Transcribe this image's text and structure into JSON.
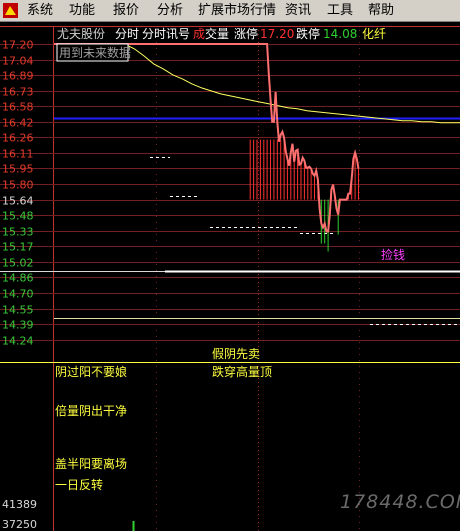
{
  "menu": [
    "系统",
    "功能",
    "报价",
    "分析",
    "扩展市场行情",
    "资讯",
    "工具",
    "帮助"
  ],
  "header": {
    "stock_name": "尤夫股份",
    "view1": "分时",
    "view2": "分时讯号",
    "vol_word1": "成",
    "vol_word2": "交量",
    "limit_up_label": "涨停",
    "limit_up_value": "17.20",
    "limit_down_label": "跌停",
    "limit_down_value": "14.08",
    "sector": "化纤"
  },
  "notice": "用到未来数据",
  "price_axis": [
    "17.20",
    "17.04",
    "16.89",
    "16.73",
    "16.58",
    "16.42",
    "16.26",
    "16.11",
    "15.95",
    "15.80",
    "15.64",
    "15.48",
    "15.33",
    "15.17",
    "15.02",
    "14.86",
    "14.70",
    "14.55",
    "14.39",
    "14.24"
  ],
  "volume_axis": [
    "41389",
    "37250"
  ],
  "annotations": {
    "a1": "假阴先卖",
    "a2": "跌穿高量顶",
    "a3": "阴过阳不要娘",
    "a4": "倍量阴出干净",
    "a5": "盖半阳要离场",
    "a6": "一日反转",
    "pickup": "捡钱"
  },
  "watermark": "178448.COM",
  "colors": {
    "up": "#ff3030",
    "down": "#30d030",
    "avg": "#ffff60",
    "blue": "#2020ff",
    "annotation": "#ffff40",
    "pickup": "#ff40ff",
    "bg": "#000000"
  },
  "chart_data": {
    "type": "line",
    "base_price": 15.64,
    "price": [
      17.2,
      17.2,
      17.2,
      17.2,
      17.2,
      17.2,
      17.2,
      17.2,
      17.2,
      17.2,
      17.2,
      17.2,
      17.2,
      17.2,
      17.2,
      17.2,
      17.2,
      17.2,
      17.2,
      17.2,
      17.2,
      17.2,
      17.2,
      17.2,
      17.2,
      17.2,
      17.2,
      17.2,
      17.2,
      17.2,
      17.2,
      17.2,
      17.2,
      17.2,
      17.2,
      17.2,
      17.2,
      17.2,
      17.2,
      17.2,
      17.2,
      17.2,
      17.2,
      17.2,
      17.2,
      17.2,
      17.2,
      17.2,
      17.2,
      17.2,
      17.2,
      17.2,
      17.2,
      17.2,
      17.2,
      17.2,
      17.2,
      17.2,
      17.2,
      17.2,
      17.2,
      17.2,
      17.2,
      17.2,
      17.2,
      17.2,
      17.2,
      17.2,
      17.2,
      17.2,
      17.2,
      17.2,
      17.2,
      17.2,
      17.2,
      17.2,
      17.2,
      17.2,
      17.2,
      17.2,
      17.2,
      17.2,
      17.2,
      17.2,
      17.2,
      17.2,
      17.2,
      17.2,
      17.2,
      17.2,
      17.2,
      17.2,
      17.2,
      17.2,
      17.2,
      17.2,
      17.2,
      17.2,
      17.2,
      17.2,
      17.2,
      17.2,
      17.2,
      17.2,
      17.2,
      17.2,
      17.2,
      17.2,
      17.2,
      17.2,
      17.2,
      17.2,
      17.2,
      17.2,
      17.2,
      17.2,
      17.2,
      17.2,
      17.2,
      17.2,
      17.2,
      17.2,
      17.2,
      17.2,
      17.2,
      17.2,
      17.2,
      16.9,
      16.65,
      16.42,
      16.42,
      16.72,
      16.42,
      16.22,
      16.29,
      16.32,
      16.26,
      16.12,
      16.05,
      15.98,
      16.11,
      16.2,
      16.02,
      16.13,
      16.14,
      15.99,
      16.0,
      16.06,
      16.03,
      15.96,
      15.96,
      15.97,
      15.95,
      15.9,
      15.88,
      15.93,
      15.84,
      15.55,
      15.4,
      15.36,
      15.4,
      15.32,
      15.32,
      15.48,
      15.74,
      15.79,
      15.68,
      15.55,
      15.49,
      15.64,
      15.64,
      15.64,
      15.64,
      15.64,
      15.7,
      15.7,
      15.85,
      16.05,
      16.11,
      16.05,
      15.95
    ],
    "avg_price": [
      17.2,
      17.15,
      17.08,
      17.0,
      16.95,
      16.89,
      16.85,
      16.8,
      16.76,
      16.73,
      16.7,
      16.68,
      16.66,
      16.64,
      16.62,
      16.6,
      16.58,
      16.56,
      16.55,
      16.53,
      16.52,
      16.51,
      16.5,
      16.49,
      16.48,
      16.47,
      16.46,
      16.45,
      16.44,
      16.43,
      16.43,
      16.42,
      16.42,
      16.41,
      16.41,
      16.41
    ],
    "volume": [
      37250,
      41389
    ],
    "ylim": [
      14.08,
      17.2
    ]
  }
}
